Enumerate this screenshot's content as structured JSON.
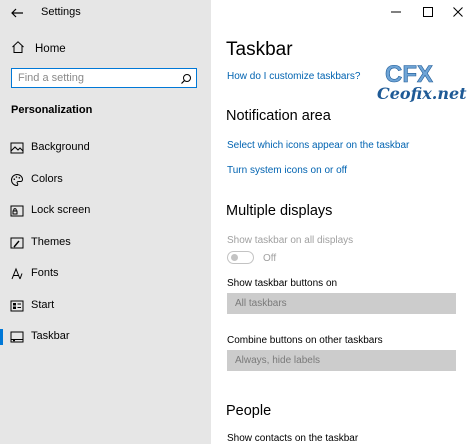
{
  "window": {
    "title": "Settings",
    "controls": {
      "minimize": "—",
      "maximize": "☐",
      "close": "✕"
    }
  },
  "sidebar": {
    "home_label": "Home",
    "search_placeholder": "Find a setting",
    "section_title": "Personalization",
    "items": [
      {
        "label": "Background",
        "icon": "picture-icon"
      },
      {
        "label": "Colors",
        "icon": "palette-icon"
      },
      {
        "label": "Lock screen",
        "icon": "lock-screen-icon"
      },
      {
        "label": "Themes",
        "icon": "brush-icon"
      },
      {
        "label": "Fonts",
        "icon": "font-icon"
      },
      {
        "label": "Start",
        "icon": "start-icon"
      },
      {
        "label": "Taskbar",
        "icon": "taskbar-icon",
        "active": true
      }
    ]
  },
  "main": {
    "title": "Taskbar",
    "help_link": "How do I customize taskbars?",
    "notification_area": {
      "heading": "Notification area",
      "link_icons": "Select which icons appear on the taskbar",
      "link_system_icons": "Turn system icons on or off"
    },
    "multiple_displays": {
      "heading": "Multiple displays",
      "show_all_label": "Show taskbar on all displays",
      "toggle_state": "Off",
      "show_buttons_label": "Show taskbar buttons on",
      "show_buttons_value": "All taskbars",
      "combine_label": "Combine buttons on other taskbars",
      "combine_value": "Always, hide labels"
    },
    "people": {
      "heading": "People",
      "show_contacts_label": "Show contacts on the taskbar"
    }
  },
  "watermark": {
    "logo_text": "CFX",
    "site_text": "Ceofix.net"
  },
  "colors": {
    "accent": "#0078d7",
    "link": "#0063b1",
    "sidebar_bg": "#e6e6e6",
    "disabled": "#a0a0a0"
  }
}
